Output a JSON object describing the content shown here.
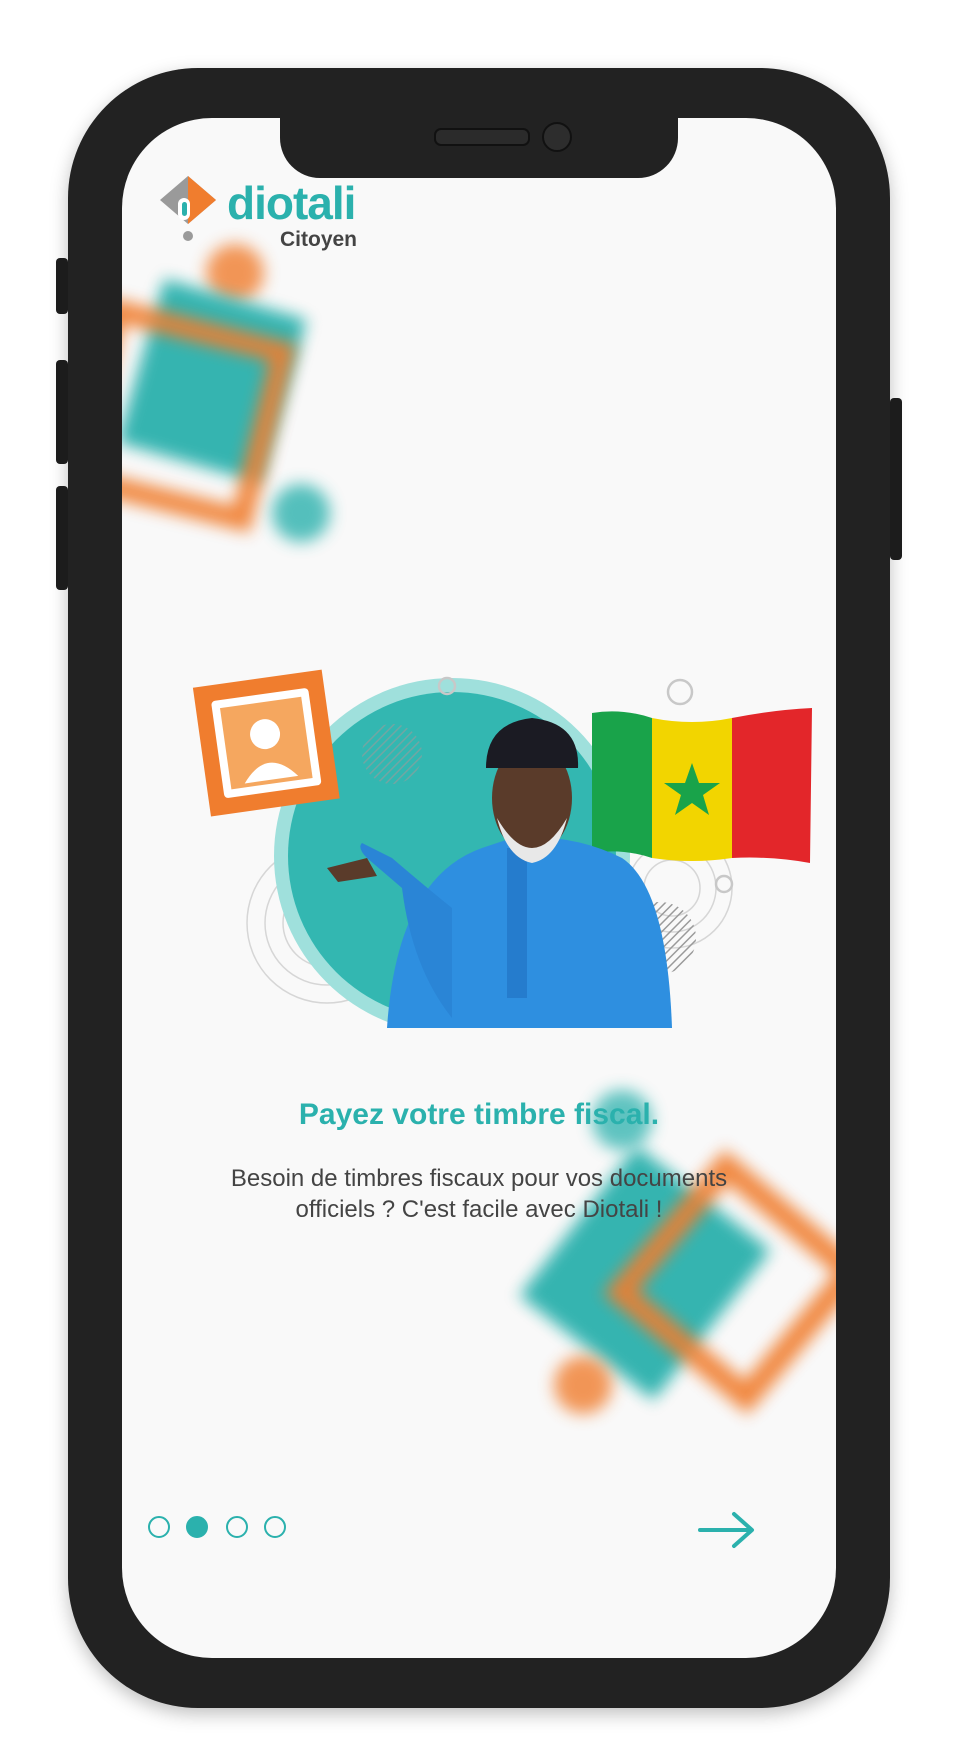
{
  "app": {
    "logo_name": "diotali",
    "logo_sub": "Citoyen"
  },
  "onboarding": {
    "title": "Payez votre timbre fiscal.",
    "description": "Besoin de timbres fiscaux pour vos documents officiels ? C'est facile avec Diotali !",
    "page_indicator": {
      "total": 4,
      "current": 2
    },
    "next_icon": "arrow-right-icon"
  },
  "colors": {
    "teal": "#2bb1ad",
    "orange": "#f07d2e",
    "dark_text": "#444444"
  }
}
